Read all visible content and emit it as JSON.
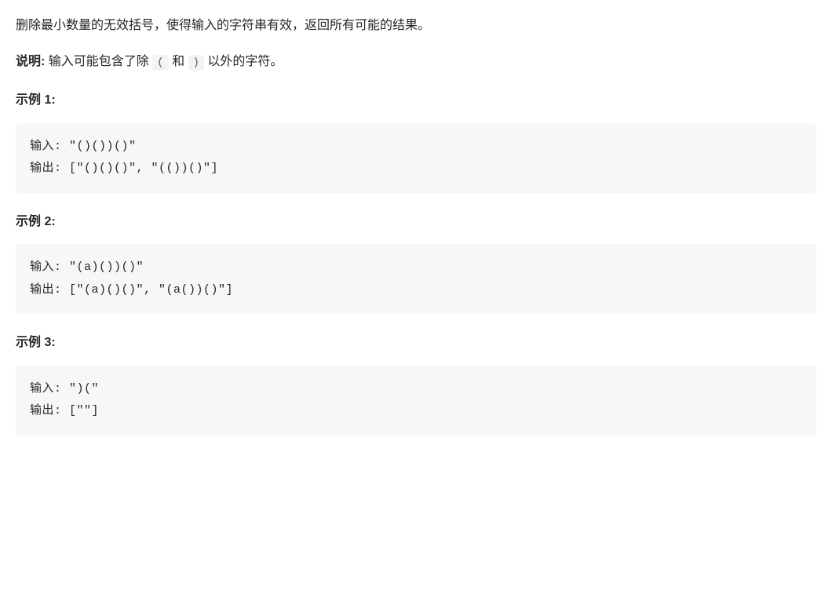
{
  "intro": "删除最小数量的无效括号，使得输入的字符串有效，返回所有可能的结果。",
  "note": {
    "label": "说明: ",
    "before": "输入可能包含了除 ",
    "code1": "(",
    "mid": " 和 ",
    "code2": ")",
    "after": " 以外的字符。"
  },
  "examples": [
    {
      "title": "示例 1:",
      "code": "输入: \"()())()\"\n输出: [\"()()()\", \"(())()\"]"
    },
    {
      "title": "示例 2:",
      "code": "输入: \"(a)())()\"\n输出: [\"(a)()()\", \"(a())()\"]"
    },
    {
      "title": "示例 3:",
      "code": "输入: \")(\"\n输出: [\"\"]"
    }
  ]
}
